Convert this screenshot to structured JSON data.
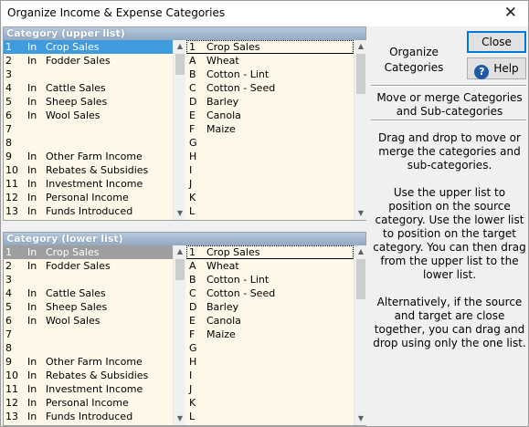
{
  "window": {
    "title": "Organize Income & Expense Categories",
    "close_glyph": "✕"
  },
  "upper": {
    "header": "Category (upper list)",
    "categories": [
      {
        "num": "1",
        "io": "In",
        "name": "Crop Sales"
      },
      {
        "num": "2",
        "io": "In",
        "name": "Fodder Sales"
      },
      {
        "num": "3",
        "io": "",
        "name": ""
      },
      {
        "num": "4",
        "io": "In",
        "name": "Cattle Sales"
      },
      {
        "num": "5",
        "io": "In",
        "name": "Sheep Sales"
      },
      {
        "num": "6",
        "io": "In",
        "name": "Wool Sales"
      },
      {
        "num": "7",
        "io": "",
        "name": ""
      },
      {
        "num": "8",
        "io": "",
        "name": ""
      },
      {
        "num": "9",
        "io": "In",
        "name": "Other Farm Income"
      },
      {
        "num": "10",
        "io": "In",
        "name": "Rebates & Subsidies"
      },
      {
        "num": "11",
        "io": "In",
        "name": "Investment Income"
      },
      {
        "num": "12",
        "io": "In",
        "name": "Personal Income"
      },
      {
        "num": "13",
        "io": "In",
        "name": "Funds Introduced"
      }
    ],
    "subcategories": [
      {
        "code": "1",
        "name": "Crop Sales"
      },
      {
        "code": "A",
        "name": "Wheat"
      },
      {
        "code": "B",
        "name": "Cotton - Lint"
      },
      {
        "code": "C",
        "name": "Cotton - Seed"
      },
      {
        "code": "D",
        "name": "Barley"
      },
      {
        "code": "E",
        "name": "Canola"
      },
      {
        "code": "F",
        "name": "Maize"
      },
      {
        "code": "G",
        "name": ""
      },
      {
        "code": "H",
        "name": ""
      },
      {
        "code": "I",
        "name": ""
      },
      {
        "code": "J",
        "name": ""
      },
      {
        "code": "K",
        "name": ""
      },
      {
        "code": "L",
        "name": ""
      }
    ]
  },
  "lower": {
    "header": "Category (lower list)",
    "categories": [
      {
        "num": "1",
        "io": "In",
        "name": "Crop Sales"
      },
      {
        "num": "2",
        "io": "In",
        "name": "Fodder Sales"
      },
      {
        "num": "3",
        "io": "",
        "name": ""
      },
      {
        "num": "4",
        "io": "In",
        "name": "Cattle Sales"
      },
      {
        "num": "5",
        "io": "In",
        "name": "Sheep Sales"
      },
      {
        "num": "6",
        "io": "In",
        "name": "Wool Sales"
      },
      {
        "num": "7",
        "io": "",
        "name": ""
      },
      {
        "num": "8",
        "io": "",
        "name": ""
      },
      {
        "num": "9",
        "io": "In",
        "name": "Other Farm Income"
      },
      {
        "num": "10",
        "io": "In",
        "name": "Rebates & Subsidies"
      },
      {
        "num": "11",
        "io": "In",
        "name": "Investment Income"
      },
      {
        "num": "12",
        "io": "In",
        "name": "Personal Income"
      },
      {
        "num": "13",
        "io": "In",
        "name": "Funds Introduced"
      }
    ],
    "subcategories": [
      {
        "code": "1",
        "name": "Crop Sales"
      },
      {
        "code": "A",
        "name": "Wheat"
      },
      {
        "code": "B",
        "name": "Cotton - Lint"
      },
      {
        "code": "C",
        "name": "Cotton - Seed"
      },
      {
        "code": "D",
        "name": "Barley"
      },
      {
        "code": "E",
        "name": "Canola"
      },
      {
        "code": "F",
        "name": "Maize"
      },
      {
        "code": "G",
        "name": ""
      },
      {
        "code": "H",
        "name": ""
      },
      {
        "code": "I",
        "name": ""
      },
      {
        "code": "J",
        "name": ""
      },
      {
        "code": "K",
        "name": ""
      },
      {
        "code": "L",
        "name": ""
      }
    ]
  },
  "scroll": {
    "up_arrow": "▲",
    "down_arrow": "▼"
  },
  "side": {
    "heading_line1": "Organize",
    "heading_line2": "Categories",
    "close_label": "Close",
    "help_label": "Help",
    "help_icon": "?",
    "description": "Move or merge Categories and Sub-categories",
    "help_p1": "Drag and drop to move or merge the categories and sub-categories.",
    "help_p2": "Use the upper list to position on the source category. Use the lower list to position on the target category. You can then drag from the upper list to the lower list.",
    "help_p3": "Alternatively, if the source and target are close together, you can drag and drop using only the one list."
  },
  "colors": {
    "list_background": "#fdf8e8",
    "header_gradient_top": "#b5c8dd",
    "upper_selection": "#3f9ade",
    "lower_selection": "#9e9e9e"
  },
  "icons": {
    "close": "close-icon",
    "help": "help-icon",
    "scroll_up": "scroll-up-arrow-icon",
    "scroll_down": "scroll-down-arrow-icon"
  }
}
